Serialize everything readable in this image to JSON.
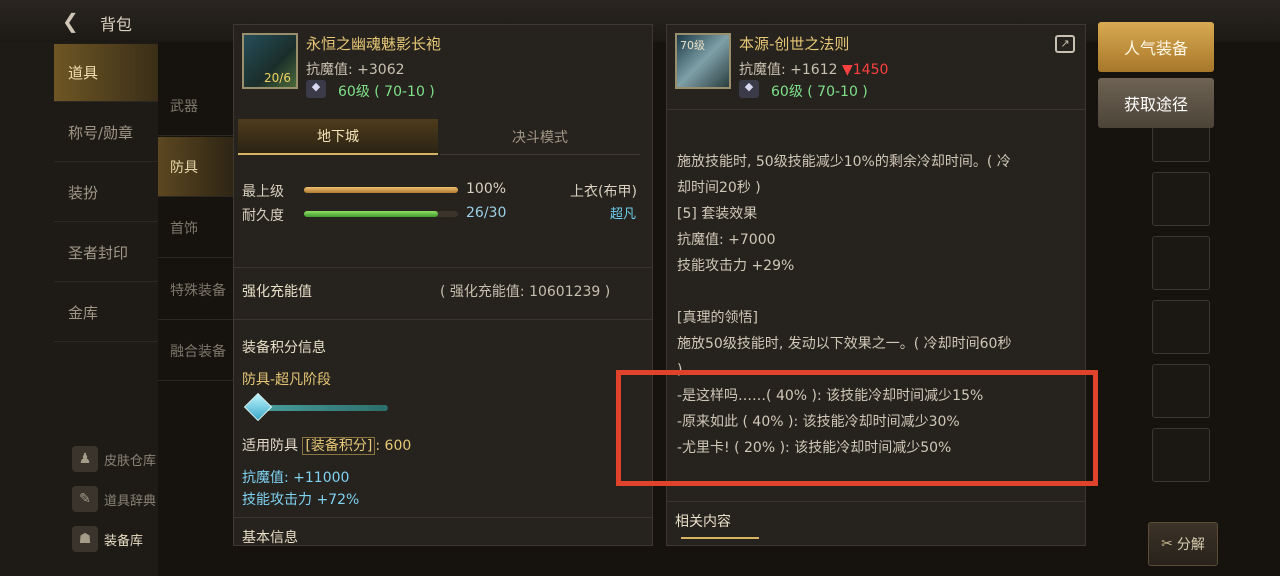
{
  "header": {
    "back_icon": "back-arrow-icon",
    "title": "背包"
  },
  "sidebar": {
    "items": [
      {
        "label": "道具"
      },
      {
        "label": "称号/勋章"
      },
      {
        "label": "装扮"
      },
      {
        "label": "圣者封印"
      },
      {
        "label": "金库"
      }
    ],
    "bottom": [
      {
        "icon": "skin-storage-icon",
        "label": "皮肤仓库"
      },
      {
        "icon": "item-dictionary-icon",
        "label": "道具辞典"
      },
      {
        "icon": "equipment-library-icon",
        "label": "装备库"
      }
    ]
  },
  "subnav": {
    "items": [
      {
        "label": "武器"
      },
      {
        "label": "防具"
      },
      {
        "label": "首饰"
      },
      {
        "label": "特殊装备"
      },
      {
        "label": "融合装备"
      }
    ]
  },
  "left_panel": {
    "item_name": "永恒之幽魂魅影长袍",
    "magic_def_label": "抗魔值: +3062",
    "level_range": "60级 ( 70-10 )",
    "icon_count": "20/6",
    "tabs": [
      {
        "label": "地下城"
      },
      {
        "label": "决斗模式"
      }
    ],
    "upgrade_label": "最上级",
    "upgrade_value": "100%",
    "durability_label": "耐久度",
    "durability_value": "26/30",
    "durability_fraction": 0.87,
    "slot_type": "上衣(布甲)",
    "rarity": "超凡",
    "charge_label": "强化充能值",
    "charge_value": "( 强化充能值: 10601239 )",
    "score_title": "装备积分信息",
    "stage_label": "防具-超凡阶段",
    "score_prefix": "适用防具",
    "score_tag": "[装备积分]",
    "score_value": ": 600",
    "stat1": "抗魔值: +11000",
    "stat2": "技能攻击力 +72%",
    "basic_info": "基本信息"
  },
  "right_panel": {
    "item_name": "本源-创世之法则",
    "icon_level": "70级",
    "magic_def_label": "抗魔值: +1612",
    "magic_def_diff": "▼1450",
    "level_range": "60级 ( 70-10 )",
    "lines": [
      "施放技能时, 50级技能减少10%的剩余冷却时间。( 冷",
      "却时间20秒 )",
      "[5] 套装效果",
      "抗魔值: +7000",
      "技能攻击力 +29%",
      "",
      "[真理的领悟]",
      "施放50级技能时, 发动以下效果之一。( 冷却时间60秒",
      "  )"
    ],
    "effects": [
      "-是这样吗……( 40% ): 该技能冷却时间减少15%",
      "-原来如此 ( 40% ):  该技能冷却时间减少30%",
      "-尤里卡! ( 20% ):  该技能冷却时间减少50%"
    ],
    "related": "相关内容"
  },
  "buttons": {
    "popular": "人气装备",
    "acquire": "获取途径",
    "decompose": "分解"
  },
  "colors": {
    "gold": "#e6c776",
    "highlight_red": "#e0432c",
    "green": "#7fe08a",
    "diff_red": "#ff4040"
  }
}
